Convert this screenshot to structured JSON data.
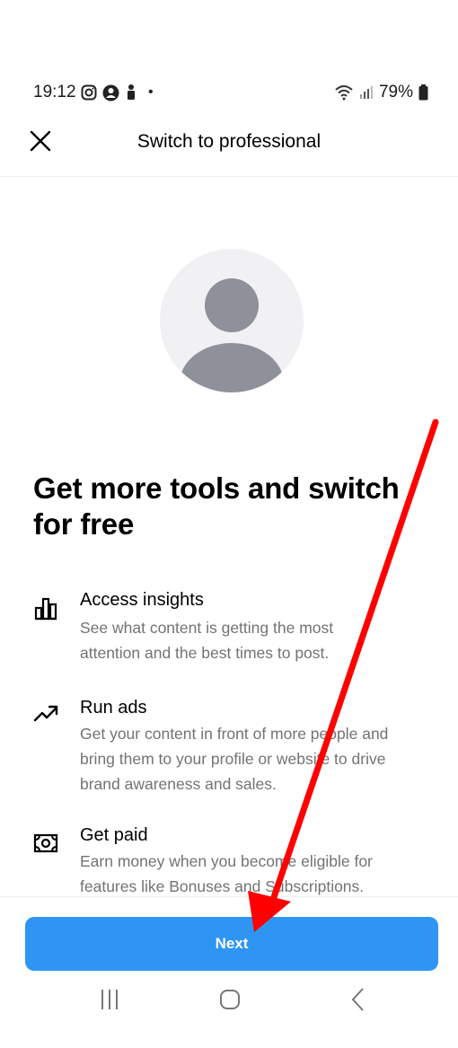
{
  "status_bar": {
    "time": "19:12",
    "dot": "•",
    "battery": "79%"
  },
  "header": {
    "title": "Switch to professional"
  },
  "headline": "Get more tools and switch for free",
  "features": [
    {
      "icon": "bar-chart-icon",
      "title": "Access insights",
      "desc_lines": [
        "See what content is getting the most",
        "attention and the best times to post."
      ]
    },
    {
      "icon": "trend-up-icon",
      "title": "Run ads",
      "desc_lines": [
        "Get your content in front of more people and",
        "bring them to your profile or website to drive",
        "brand awareness and sales."
      ]
    },
    {
      "icon": "money-icon",
      "title": "Get paid",
      "desc_lines": [
        "Earn money when you become eligible for",
        "features like Bonuses and Subscriptions."
      ]
    }
  ],
  "next_label": "Next",
  "colors": {
    "primary_button": "#2e96f2",
    "secondary_text": "#737373",
    "annotation_arrow": "#ff0000"
  }
}
